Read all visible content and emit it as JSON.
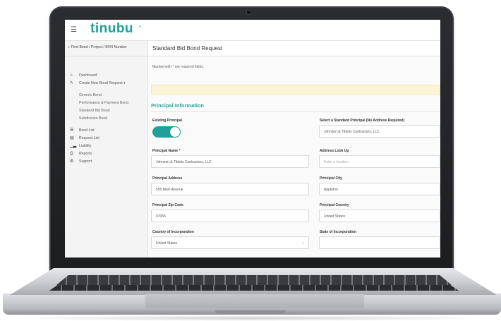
{
  "app": {
    "logo": "tinubu",
    "logo_mark": "°"
  },
  "sidebar": {
    "search_label": "Find Bond / Project / BVN Number",
    "items": [
      {
        "label": "Dashboard",
        "icon": "home-icon"
      },
      {
        "label": "Create New Bond Request",
        "icon": "pencil-icon"
      }
    ],
    "sub_items": [
      "Generic Bond",
      "Performance & Payment Bond",
      "Standard Bid Bond",
      "Subdivision Bond"
    ],
    "items2": [
      {
        "label": "Bond List",
        "icon": "list-icon"
      },
      {
        "label": "Request List",
        "icon": "clipboard-icon"
      },
      {
        "label": "Liability",
        "icon": "chart-icon"
      },
      {
        "label": "Reports",
        "icon": "document-icon"
      },
      {
        "label": "Support",
        "icon": "gear-icon"
      }
    ]
  },
  "page": {
    "title": "Standard Bid Bond Request",
    "required_note": "Marked with * are required fields.",
    "section_title": "Principal Information"
  },
  "form": {
    "existing_principal": {
      "label": "Existing Principal",
      "value": "on"
    },
    "select_principal": {
      "label": "Select a Standard Principal (No Address Required)",
      "value": "Johnson & Tibbits Contractors, LLC"
    },
    "principal_name": {
      "label": "Principal Name *",
      "value": "Johnson & Tibbits Contractors, LLC"
    },
    "address_lookup": {
      "label": "Address Look Up",
      "placeholder": "Enter a location"
    },
    "principal_address": {
      "label": "Principal Address",
      "value": "555 Main Avenue"
    },
    "principal_city": {
      "label": "Principal City",
      "value": "Appleton"
    },
    "zip_code": {
      "label": "Principal Zip Code",
      "value": "07055"
    },
    "principal_country": {
      "label": "Principal Country",
      "value": "United States"
    },
    "country_of_incorporation": {
      "label": "Country of Incorporation",
      "value": "United States"
    },
    "state_of_incorporation": {
      "label": "State of Incorporation",
      "value": ""
    }
  },
  "colors": {
    "accent": "#1fa09a",
    "alert_bg": "#fcf4d6",
    "laptop_frame": "#222325"
  }
}
